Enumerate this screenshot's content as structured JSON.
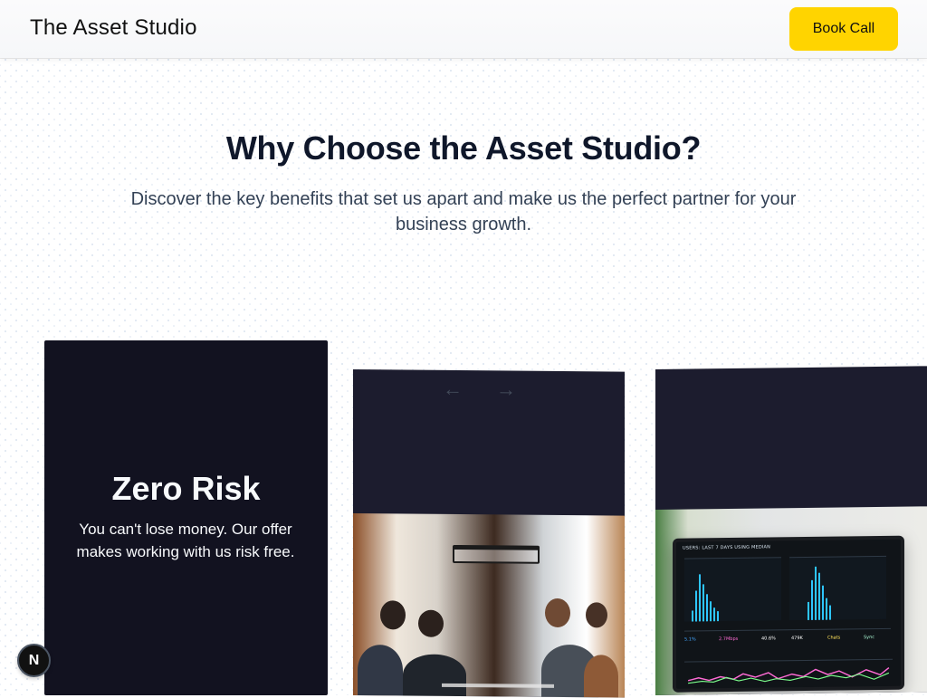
{
  "brand": {
    "name": "The Asset Studio"
  },
  "header": {
    "book_call_label": "Book Call"
  },
  "hero": {
    "title": "Why Choose the Asset Studio?",
    "subtitle": "Discover the key benefits that set us apart and make us the perfect partner for your business growth."
  },
  "cards": {
    "zero_risk": {
      "title": "Zero Risk",
      "description": "You can't lose money. Our offer makes working with us risk free."
    },
    "team": {
      "arrows": {
        "left": "←",
        "right": "→"
      }
    },
    "analytics": {
      "monitor_header": "USERS: LAST 7 DAYS USING MEDIAN",
      "metrics": [
        "5.1%",
        "2.7Mbps",
        "40.6%",
        "479K",
        "Chats",
        "Sync"
      ]
    }
  },
  "badge": {
    "letter": "N"
  },
  "colors": {
    "accent": "#FFD400",
    "dark_card": "#121220",
    "panel_card": "#1C1C2E"
  },
  "icons": {
    "left_arrow": "arrow-left-icon",
    "right_arrow": "arrow-right-icon",
    "nextjs": "nextjs-icon"
  }
}
